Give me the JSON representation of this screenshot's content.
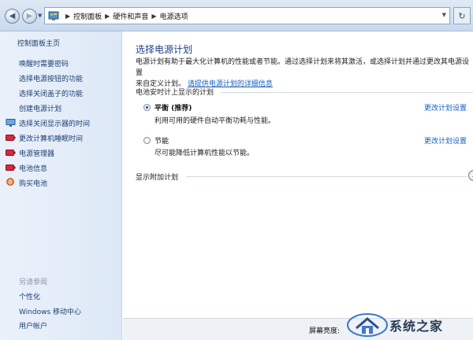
{
  "breadcrumb": {
    "items": [
      "控制面板",
      "硬件和声音",
      "电源选项"
    ],
    "separator": "▶"
  },
  "sidebar": {
    "home": "控制面板主页",
    "links": [
      {
        "label": "唤醒时需要密码",
        "icon": null
      },
      {
        "label": "选择电源按钮的功能",
        "icon": null
      },
      {
        "label": "选择关闭盖子的功能",
        "icon": null
      },
      {
        "label": "创建电源计划",
        "icon": null
      },
      {
        "label": "选择关闭显示器的时间",
        "icon": "monitor-icon"
      },
      {
        "label": "更改计算机睡眠时间",
        "icon": "battery-icon"
      },
      {
        "label": "电源管理器",
        "icon": "battery-icon"
      },
      {
        "label": "电池信息",
        "icon": "battery-icon"
      },
      {
        "label": "购买电池",
        "icon": "globe-icon"
      }
    ],
    "see_also_title": "另请参阅",
    "see_also": [
      "个性化",
      "Windows 移动中心",
      "用户帐户"
    ]
  },
  "main": {
    "title": "选择电源计划",
    "description_1": "电源计划有助于最大化计算机的性能或者节能。通过选择计划来将其激活，或选择计划并通过更改其电源设置",
    "description_2": "来自定义计划。",
    "description_link": "请提供电源计划的详细信息",
    "group_header": "电池安时计上显示的计划",
    "plans": [
      {
        "name": "平衡 (推荐)",
        "description": "利用可用的硬件自动平衡功耗与性能。",
        "link": "更改计划设置",
        "selected": true
      },
      {
        "name": "节能",
        "description": "尽可能降低计算机性能以节能。",
        "link": "更改计划设置",
        "selected": false
      }
    ],
    "more_plans_label": "显示附加计划"
  },
  "footer": {
    "brightness_label": "屏幕亮度:"
  },
  "watermark": {
    "text": "系统之家"
  },
  "colors": {
    "link": "#1760c0",
    "title": "#1f3f86",
    "nav_link": "#1e3f73"
  }
}
